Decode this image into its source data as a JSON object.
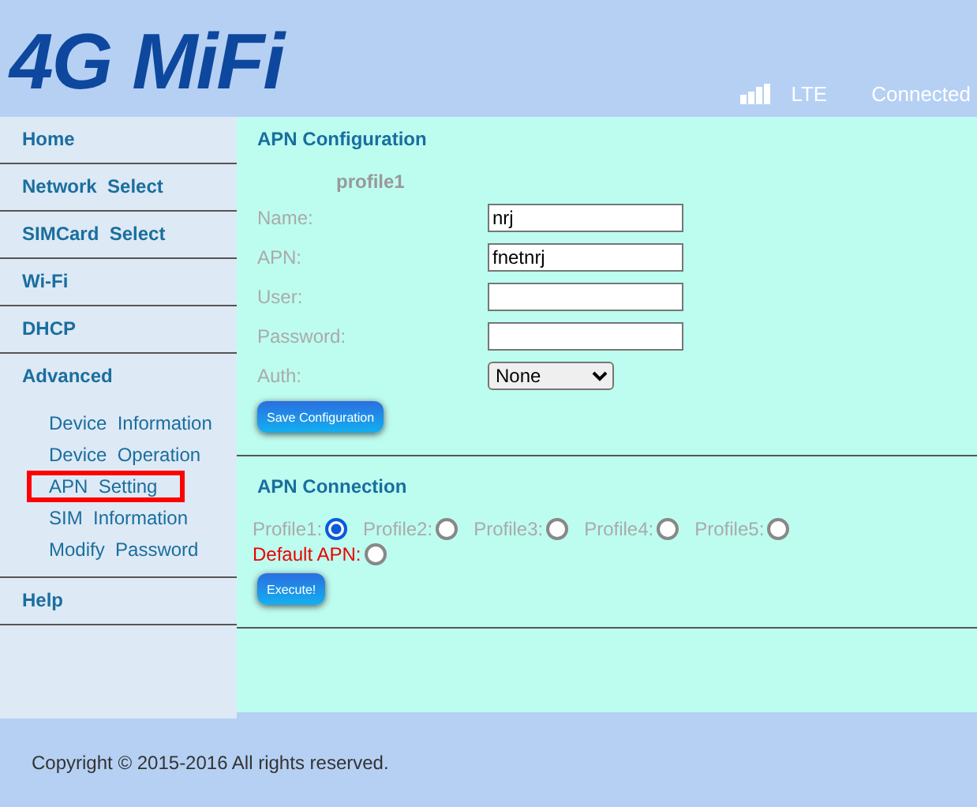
{
  "header": {
    "logo": "4G MiFi",
    "network": "LTE",
    "status": "Connected"
  },
  "sidebar": {
    "items": [
      {
        "label": "Home"
      },
      {
        "label": "Network  Select"
      },
      {
        "label": "SIMCard  Select"
      },
      {
        "label": "Wi-Fi"
      },
      {
        "label": "DHCP"
      },
      {
        "label": "Advanced",
        "children": [
          {
            "label": "Device  Information",
            "highlighted": false
          },
          {
            "label": "Device  Operation",
            "highlighted": false
          },
          {
            "label": "APN  Setting",
            "highlighted": true
          },
          {
            "label": "SIM  Information",
            "highlighted": false
          },
          {
            "label": "Modify  Password",
            "highlighted": false
          }
        ]
      },
      {
        "label": "Help"
      }
    ]
  },
  "apn_configuration": {
    "title": "APN Configuration",
    "profile": "profile1",
    "fields": [
      {
        "kind": "text",
        "label": "Name:",
        "value": "nrj"
      },
      {
        "kind": "text",
        "label": "APN:",
        "value": "fnetnrj"
      },
      {
        "kind": "text",
        "label": "User:"
      },
      {
        "kind": "password",
        "label": "Password:"
      },
      {
        "kind": "select",
        "label": "Auth:",
        "value": "None"
      }
    ],
    "button": "Save Configuration"
  },
  "apn_connection": {
    "title": "APN Connection",
    "options": [
      {
        "label": "Profile1:",
        "selected": true,
        "kind": "profile"
      },
      {
        "label": "Profile2:",
        "selected": false,
        "kind": "profile"
      },
      {
        "label": "Profile3:",
        "selected": false,
        "kind": "profile"
      },
      {
        "label": "Profile4:",
        "selected": false,
        "kind": "profile"
      },
      {
        "label": "Profile5:",
        "selected": false,
        "kind": "profile"
      },
      {
        "label": "Default APN:",
        "selected": false,
        "kind": "default"
      }
    ],
    "button": "Execute!"
  },
  "footer": "Copyright © 2015-2016 All rights reserved."
}
